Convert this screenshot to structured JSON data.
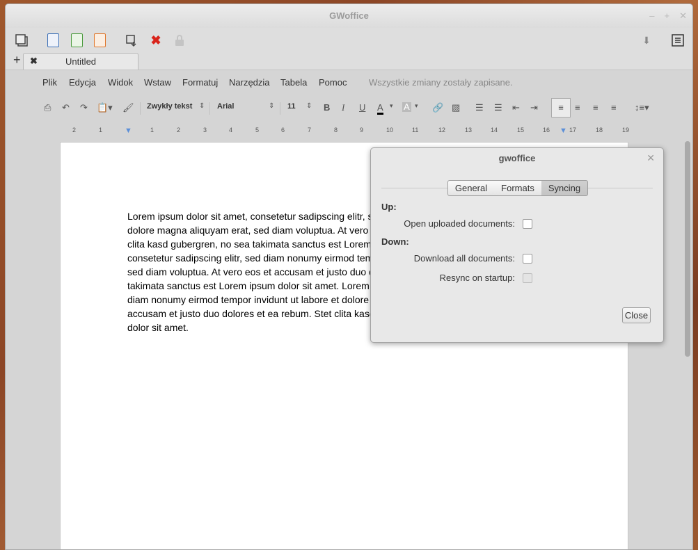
{
  "window": {
    "title": "GWoffice"
  },
  "tab": {
    "title": "Untitled"
  },
  "menu": [
    "Plik",
    "Edycja",
    "Widok",
    "Wstaw",
    "Formatuj",
    "Narzędzia",
    "Tabela",
    "Pomoc"
  ],
  "status_message": "Wszystkie zmiany zostały zapisane.",
  "format": {
    "style": "Zwykły tekst",
    "font": "Arial",
    "size": "11"
  },
  "ruler_labels": [
    "2",
    "1",
    "1",
    "2",
    "3",
    "4",
    "5",
    "6",
    "7",
    "8",
    "9",
    "10",
    "11",
    "12",
    "13",
    "14",
    "15",
    "16",
    "17",
    "18",
    "19"
  ],
  "document_text": "Lorem ipsum dolor sit amet, consetetur sadipscing elitr, sed diam nonumy eirmod tempor invidunt ut labore et dolore magna aliquyam erat, sed diam voluptua. At vero eos et accusam et justo duo dolores et ea rebum. Stet clita kasd gubergren, no sea takimata sanctus est Lorem ipsum dolor sit amet. Lorem ipsum dolor sit amet, consetetur sadipscing elitr, sed diam nonumy eirmod tempor invidunt ut labore et dolore magna aliquyam erat, sed diam voluptua. At vero eos et accusam et justo duo dolores et ea rebum. Stet clita kasd gubergren, no sea takimata sanctus est Lorem ipsum dolor sit amet. Lorem ipsum dolor sit amet, consetetur sadipscing elitr, sed diam nonumy eirmod tempor invidunt ut labore et dolore magna aliquyam erat, sed diam voluptua. At vero eos et accusam et justo duo dolores et ea rebum. Stet clita kasd gubergren, no sea takimata sanctus est Lorem ipsum dolor sit amet.",
  "dialog": {
    "title": "gwoffice",
    "tabs": [
      "General",
      "Formats",
      "Syncing"
    ],
    "up_label": "Up:",
    "open_uploaded": "Open uploaded documents:",
    "down_label": "Down:",
    "download_all": "Download all documents:",
    "resync": "Resync on startup:",
    "close": "Close"
  },
  "colors": {
    "accent_red": "#d9241b",
    "doc_blue": "#3b6fb6",
    "sheet_green": "#4a9a3c",
    "slides_orange": "#e0762a"
  }
}
